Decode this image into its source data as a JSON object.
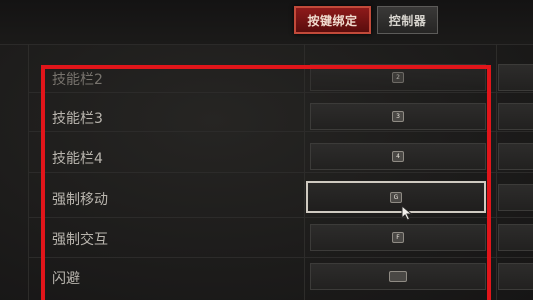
{
  "tabs": [
    {
      "label": "按键绑定",
      "active": true
    },
    {
      "label": "控制器",
      "active": false
    }
  ],
  "bindings": [
    {
      "action": "技能栏2",
      "key": "2"
    },
    {
      "action": "技能栏3",
      "key": "3"
    },
    {
      "action": "技能栏4",
      "key": "4"
    },
    {
      "action": "强制移动",
      "key": "G"
    },
    {
      "action": "强制交互",
      "key": "F"
    },
    {
      "action": "闪避",
      "key": "space-icon"
    }
  ],
  "selected_action": "强制移动",
  "colors": {
    "highlight_frame": "#e1151a",
    "active_tab": "#8e1a1a",
    "label_text": "#b9b5ae"
  }
}
